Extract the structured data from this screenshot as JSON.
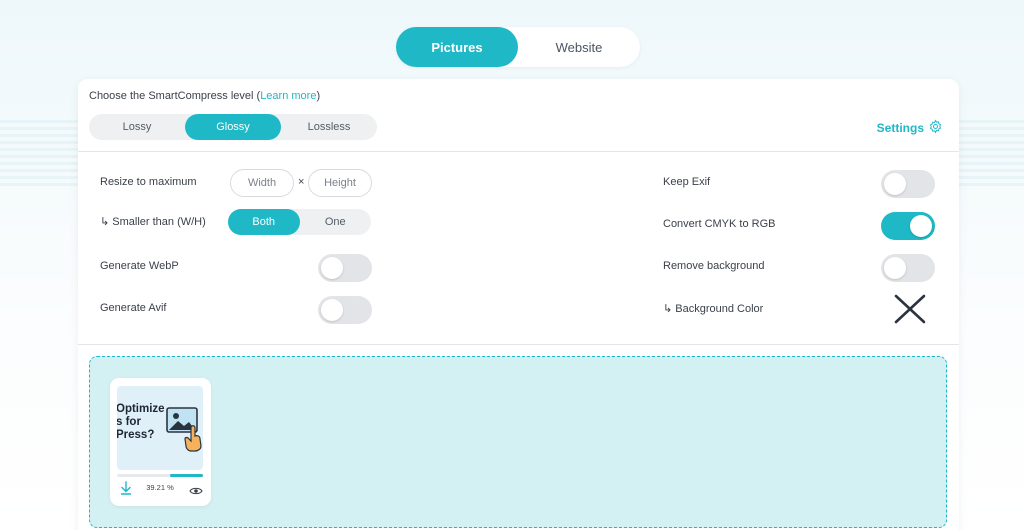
{
  "mode_tabs": [
    {
      "label": "Pictures",
      "active": true
    },
    {
      "label": "Website",
      "active": false
    }
  ],
  "compress": {
    "caption_prefix": "Choose the SmartCompress level (",
    "learn_more": "Learn more",
    "caption_suffix": ")",
    "levels": [
      {
        "label": "Lossy",
        "active": false
      },
      {
        "label": "Glossy",
        "active": true
      },
      {
        "label": "Lossless",
        "active": false
      }
    ],
    "settings_label": "Settings"
  },
  "options": {
    "resize_label": "Resize to maximum",
    "width_placeholder": "Width",
    "times_sign": "×",
    "height_placeholder": "Height",
    "smaller_label": "↳ Smaller than (W/H)",
    "smaller_choices": [
      {
        "label": "Both",
        "active": true
      },
      {
        "label": "One",
        "active": false
      }
    ],
    "webp_label": "Generate WebP",
    "webp_on": false,
    "avif_label": "Generate Avif",
    "avif_on": false,
    "exif_label": "Keep Exif",
    "exif_on": false,
    "cmyk_label": "Convert CMYK to RGB",
    "cmyk_on": true,
    "remove_bg_label": "Remove background",
    "remove_bg_on": false,
    "bg_color_label": "↳ Background Color"
  },
  "upload": {
    "file": {
      "thumb_text": "Optimize\ns for\nPress?",
      "percent": "39.21 %",
      "progress": 0.38
    }
  },
  "colors": {
    "accent": "#1fb8c6",
    "dropzone_bg": "#d3f1f2",
    "toggle_off": "#e2e4e7"
  }
}
